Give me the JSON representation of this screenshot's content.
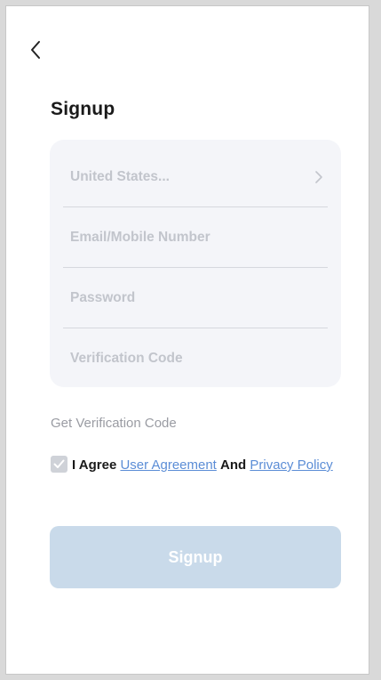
{
  "header": {
    "back_icon": "chevron-left-icon",
    "title": "Signup"
  },
  "form": {
    "country": {
      "value": "United States...",
      "icon": "chevron-right-icon"
    },
    "email": {
      "placeholder": "Email/Mobile Number"
    },
    "password": {
      "placeholder": "Password"
    },
    "verification": {
      "placeholder": "Verification Code"
    }
  },
  "get_code_label": "Get Verification Code",
  "agreement": {
    "checked": true,
    "prefix": "I Agree",
    "user_agreement": "User Agreement",
    "conjunction": "And",
    "privacy_policy": "Privacy Policy"
  },
  "signup_button": {
    "label": "Signup",
    "enabled": false
  },
  "colors": {
    "button_disabled": "#c9daea",
    "link": "#5b8dd6",
    "card": "#f4f5f9",
    "placeholder": "#c2c5cc"
  }
}
